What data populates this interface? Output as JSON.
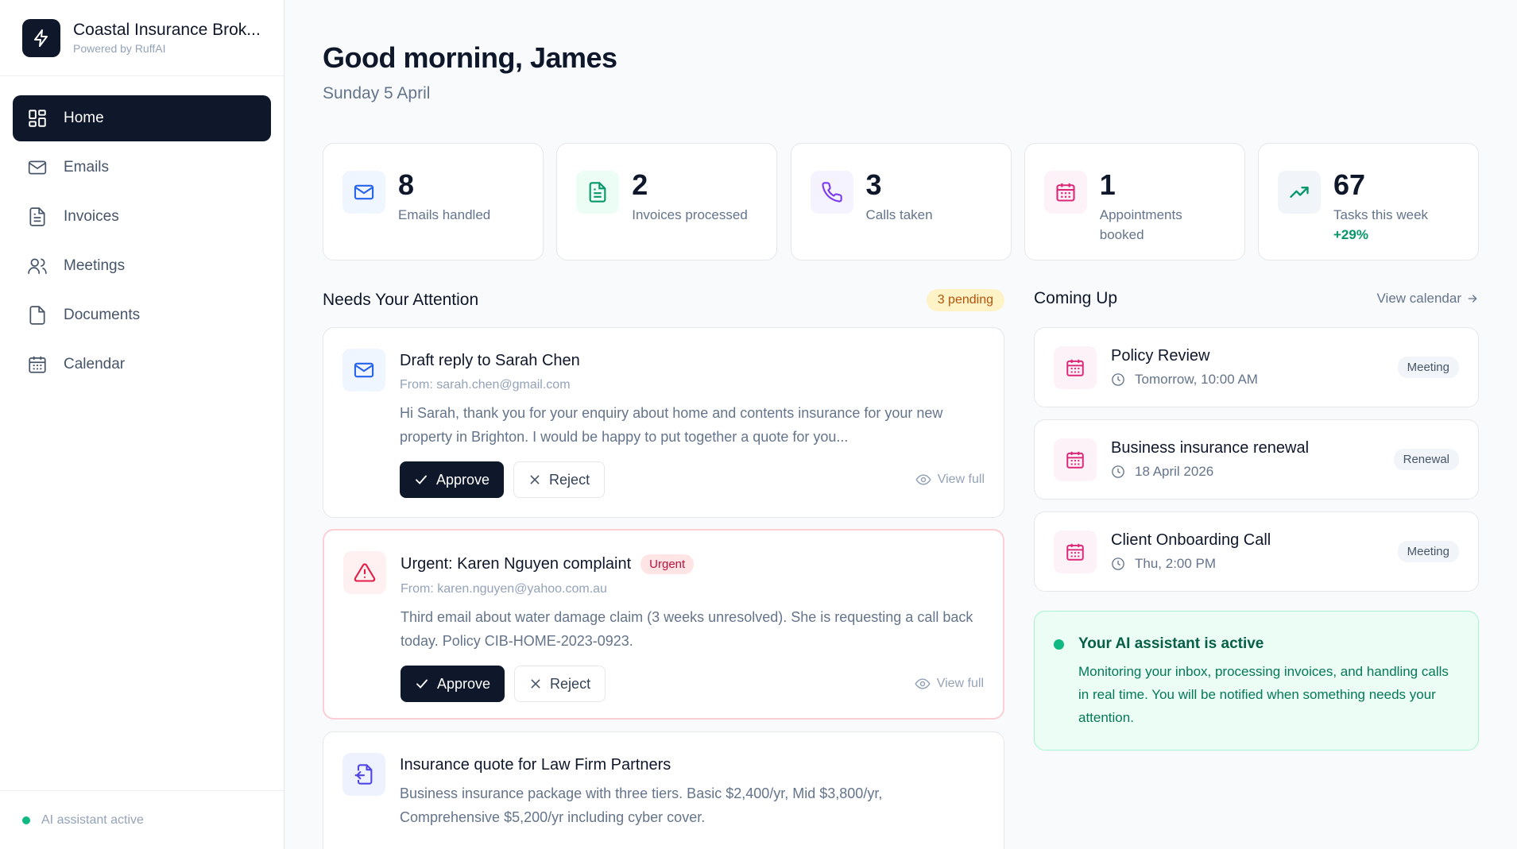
{
  "brand": {
    "name": "Coastal Insurance Brok...",
    "subtitle": "Powered by RuffAI"
  },
  "sidebar": {
    "items": [
      {
        "label": "Home",
        "icon": "grid-icon"
      },
      {
        "label": "Emails",
        "icon": "mail-icon"
      },
      {
        "label": "Invoices",
        "icon": "document-icon"
      },
      {
        "label": "Meetings",
        "icon": "users-icon"
      },
      {
        "label": "Documents",
        "icon": "file-icon"
      },
      {
        "label": "Calendar",
        "icon": "calendar-icon"
      }
    ],
    "footer": "AI assistant active"
  },
  "header": {
    "greeting": "Good morning, James",
    "date": "Sunday 5 April"
  },
  "stats": [
    {
      "value": "8",
      "label": "Emails handled",
      "color": "#2563eb"
    },
    {
      "value": "2",
      "label": "Invoices processed",
      "color": "#059669"
    },
    {
      "value": "3",
      "label": "Calls taken",
      "color": "#7c3aed"
    },
    {
      "value": "1",
      "label": "Appointments booked",
      "color": "#db2777"
    },
    {
      "value": "67",
      "label": "Tasks this week",
      "delta": "+29%",
      "color": "#059669"
    }
  ],
  "attention": {
    "title": "Needs Your Attention",
    "badge": "3 pending",
    "approve_label": "Approve",
    "reject_label": "Reject",
    "view_full_label": "View full",
    "items": [
      {
        "title": "Draft reply to Sarah Chen",
        "from": "From: sarah.chen@gmail.com",
        "text": "Hi Sarah, thank you for your enquiry about home and contents insurance for your new property in Brighton. I would be happy to put together a quote for you..."
      },
      {
        "title": "Urgent: Karen Nguyen complaint",
        "tag": "Urgent",
        "from": "From: karen.nguyen@yahoo.com.au",
        "text": "Third email about water damage claim (3 weeks unresolved). She is requesting a call back today. Policy CIB-HOME-2023-0923."
      },
      {
        "title": "Insurance quote for Law Firm Partners",
        "text": "Business insurance package with three tiers. Basic $2,400/yr, Mid $3,800/yr, Comprehensive $5,200/yr including cyber cover."
      }
    ]
  },
  "upcoming": {
    "title": "Coming Up",
    "view_calendar": "View calendar",
    "events": [
      {
        "title": "Policy Review",
        "time": "Tomorrow, 10:00 AM",
        "tag": "Meeting"
      },
      {
        "title": "Business insurance renewal",
        "time": "18 April 2026",
        "tag": "Renewal"
      },
      {
        "title": "Client Onboarding Call",
        "time": "Thu, 2:00 PM",
        "tag": "Meeting"
      }
    ]
  },
  "assistant": {
    "title": "Your AI assistant is active",
    "text": "Monitoring your inbox, processing invoices, and handling calls in real time. You will be notified when something needs your attention."
  }
}
